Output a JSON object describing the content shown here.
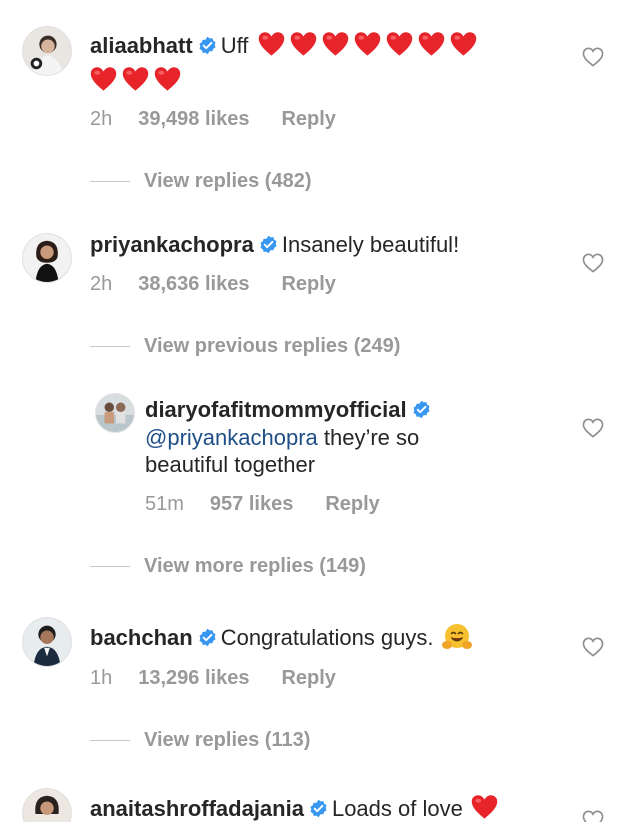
{
  "comments": [
    {
      "username": "aliaabhatt",
      "text": "Uff",
      "hearts_inline": 7,
      "hearts_second_line": 3,
      "time": "2h",
      "likes": "39,498 likes",
      "reply": "Reply",
      "view_replies": "View replies (482)"
    },
    {
      "username": "priyankachopra",
      "text": "Insanely beautiful!",
      "time": "2h",
      "likes": "38,636 likes",
      "reply": "Reply",
      "view_previous": "View previous replies (249)",
      "reply_item": {
        "username": "diaryofafitmommyofficial",
        "mention": "@priyankachopra",
        "text_1": " they’re so",
        "text_2": "beautiful together",
        "time": "51m",
        "likes": "957 likes",
        "reply": "Reply"
      },
      "view_more": "View more replies (149)"
    },
    {
      "username": "bachchan",
      "text": "Congratulations guys.",
      "emoji": "hugging-face-emoji",
      "time": "1h",
      "likes": "13,296 likes",
      "reply": "Reply",
      "view_replies": "View replies (113)"
    },
    {
      "username": "anaitashroffadajania",
      "text": "Loads of love"
    }
  ],
  "colors": {
    "text": "#262626",
    "meta": "#999999",
    "mention": "#1f4f86",
    "verified": "#3897f0",
    "heart": "#e8242b"
  }
}
